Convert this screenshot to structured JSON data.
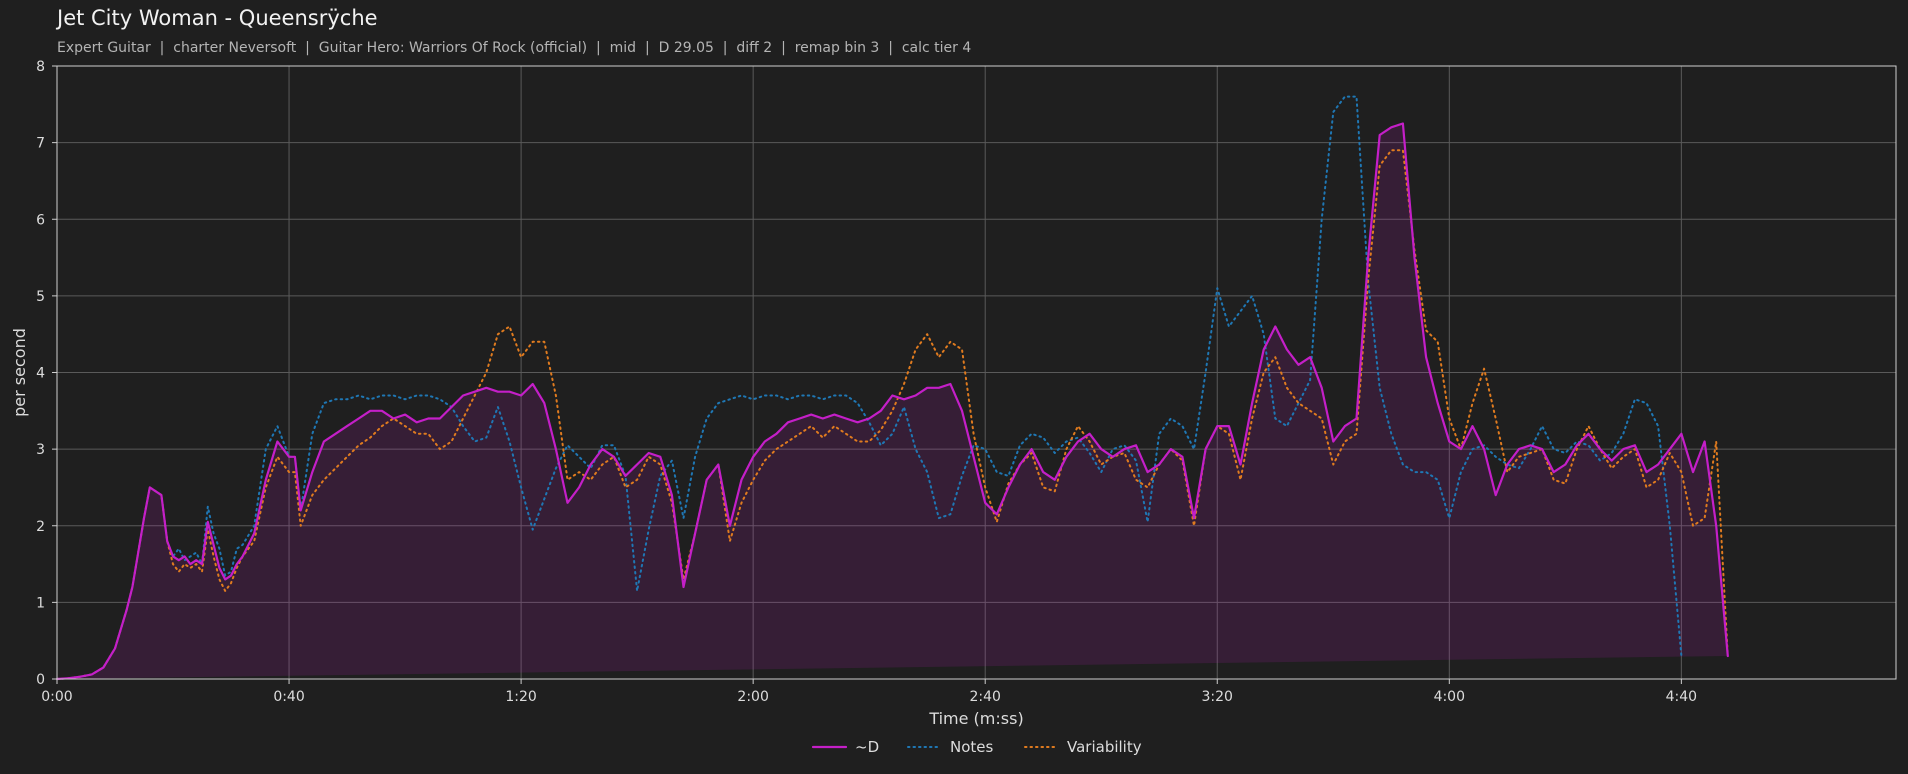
{
  "chart_data": {
    "type": "line",
    "title": "Jet City Woman - Queensrÿche",
    "subtitle": "Expert Guitar  |  charter Neversoft  |  Guitar Hero: Warriors Of Rock (official)  |  mid  |  D 29.05  |  diff 2  |  remap bin 3  |  calc tier 4",
    "xlabel": "Time (m:ss)",
    "ylabel": "per second",
    "xlim": [
      0,
      317
    ],
    "ylim": [
      0,
      8
    ],
    "x_ticks": [
      {
        "v": 0,
        "label": "0:00"
      },
      {
        "v": 40,
        "label": "0:40"
      },
      {
        "v": 80,
        "label": "1:20"
      },
      {
        "v": 120,
        "label": "2:00"
      },
      {
        "v": 160,
        "label": "2:40"
      },
      {
        "v": 200,
        "label": "3:20"
      },
      {
        "v": 240,
        "label": "4:00"
      },
      {
        "v": 280,
        "label": "4:40"
      }
    ],
    "y_ticks": [
      0,
      1,
      2,
      3,
      4,
      5,
      6,
      7,
      8
    ],
    "grid": true,
    "legend_position": "bottom-center",
    "x": [
      0,
      2,
      4,
      6,
      8,
      10,
      12,
      13,
      15,
      16,
      18,
      19,
      20,
      21,
      22,
      23,
      24,
      25,
      26,
      27,
      28,
      29,
      30,
      31,
      32,
      34,
      36,
      38,
      40,
      41,
      42,
      44,
      46,
      48,
      50,
      52,
      54,
      56,
      58,
      60,
      62,
      64,
      66,
      68,
      70,
      72,
      74,
      76,
      78,
      80,
      82,
      84,
      86,
      88,
      90,
      92,
      94,
      96,
      98,
      100,
      102,
      104,
      106,
      108,
      110,
      112,
      114,
      116,
      118,
      120,
      122,
      124,
      126,
      128,
      130,
      132,
      134,
      136,
      138,
      140,
      142,
      144,
      146,
      148,
      150,
      152,
      154,
      156,
      158,
      160,
      162,
      164,
      166,
      168,
      170,
      172,
      174,
      176,
      178,
      180,
      182,
      184,
      186,
      188,
      190,
      192,
      194,
      196,
      198,
      200,
      202,
      204,
      206,
      208,
      210,
      212,
      214,
      216,
      218,
      220,
      222,
      224,
      226,
      228,
      230,
      232,
      234,
      236,
      238,
      240,
      242,
      244,
      246,
      248,
      250,
      252,
      254,
      256,
      258,
      260,
      262,
      264,
      266,
      268,
      270,
      272,
      274,
      276,
      278,
      280,
      282,
      284,
      286,
      288,
      290,
      292,
      294,
      296,
      298,
      300,
      302,
      304,
      306,
      308,
      310,
      312,
      314,
      316,
      317
    ],
    "series": [
      {
        "name": "~D",
        "style": "solid",
        "color": "#c41fc8",
        "values": [
          0,
          0.01,
          0.03,
          0.06,
          0.15,
          0.4,
          0.9,
          1.2,
          2.1,
          2.5,
          2.4,
          1.8,
          1.6,
          1.55,
          1.6,
          1.5,
          1.55,
          1.5,
          2.05,
          1.75,
          1.45,
          1.3,
          1.35,
          1.5,
          1.6,
          1.9,
          2.6,
          3.1,
          2.9,
          2.9,
          2.2,
          2.7,
          3.1,
          3.2,
          3.3,
          3.4,
          3.5,
          3.5,
          3.4,
          3.45,
          3.35,
          3.4,
          3.4,
          3.55,
          3.7,
          3.75,
          3.8,
          3.75,
          3.75,
          3.7,
          3.85,
          3.6,
          3.0,
          2.3,
          2.5,
          2.8,
          3.0,
          2.9,
          2.65,
          2.8,
          2.95,
          2.9,
          2.4,
          1.2,
          1.9,
          2.6,
          2.8,
          2.0,
          2.6,
          2.9,
          3.1,
          3.2,
          3.35,
          3.4,
          3.45,
          3.4,
          3.45,
          3.4,
          3.35,
          3.4,
          3.5,
          3.7,
          3.65,
          3.7,
          3.8,
          3.8,
          3.85,
          3.5,
          2.9,
          2.3,
          2.15,
          2.5,
          2.8,
          3.0,
          2.7,
          2.6,
          2.9,
          3.1,
          3.2,
          3.0,
          2.9,
          3.0,
          3.05,
          2.7,
          2.8,
          3.0,
          2.9,
          2.1,
          3.0,
          3.3,
          3.3,
          2.8,
          3.6,
          4.3,
          4.6,
          4.3,
          4.1,
          4.2,
          3.8,
          3.1,
          3.3,
          3.4,
          5.5,
          7.1,
          7.2,
          7.25,
          5.5,
          4.2,
          3.6,
          3.1,
          3.0,
          3.3,
          3.0,
          2.4,
          2.8,
          3.0,
          3.05,
          3.0,
          2.7,
          2.8,
          3.05,
          3.2,
          3.0,
          2.85,
          3.0,
          3.05,
          2.7,
          2.8,
          3.0,
          3.2,
          2.7,
          3.1,
          2.0,
          0.3
        ]
      },
      {
        "name": "Notes",
        "style": "dotted",
        "color": "#1f77b4",
        "values": [
          0,
          0.01,
          0.03,
          0.06,
          0.15,
          0.4,
          0.9,
          1.2,
          2.1,
          2.5,
          2.4,
          1.8,
          1.6,
          1.7,
          1.55,
          1.6,
          1.65,
          1.5,
          2.25,
          1.9,
          1.7,
          1.35,
          1.4,
          1.7,
          1.75,
          2.0,
          3.0,
          3.3,
          2.9,
          2.9,
          2.2,
          3.2,
          3.6,
          3.65,
          3.65,
          3.7,
          3.65,
          3.7,
          3.7,
          3.65,
          3.7,
          3.7,
          3.65,
          3.55,
          3.3,
          3.1,
          3.15,
          3.55,
          3.1,
          2.5,
          1.95,
          2.35,
          2.75,
          3.05,
          2.9,
          2.75,
          3.05,
          3.05,
          2.65,
          1.15,
          1.95,
          2.65,
          2.85,
          2.1,
          2.9,
          3.4,
          3.6,
          3.65,
          3.7,
          3.65,
          3.7,
          3.7,
          3.65,
          3.7,
          3.7,
          3.65,
          3.7,
          3.7,
          3.6,
          3.35,
          3.05,
          3.2,
          3.55,
          3.0,
          2.7,
          2.1,
          2.15,
          2.65,
          3.05,
          3.0,
          2.7,
          2.65,
          3.05,
          3.2,
          3.15,
          2.95,
          3.1,
          3.15,
          2.95,
          2.7,
          3.0,
          3.05,
          2.85,
          2.05,
          3.2,
          3.4,
          3.3,
          3.0,
          4.0,
          5.1,
          4.6,
          4.8,
          5.0,
          4.5,
          3.4,
          3.3,
          3.6,
          3.9,
          6.0,
          7.4,
          7.6,
          7.6,
          5.2,
          3.8,
          3.2,
          2.8,
          2.7,
          2.7,
          2.6,
          2.1,
          2.7,
          3.0,
          3.05,
          2.9,
          2.8,
          2.75,
          3.0,
          3.3,
          3.0,
          2.95,
          3.1,
          3.05,
          2.85,
          2.95,
          3.2,
          3.65,
          3.6,
          3.3,
          2.0,
          0.3
        ]
      },
      {
        "name": "Variability",
        "style": "dotted",
        "color": "#e07b1f",
        "values": [
          0,
          0.01,
          0.03,
          0.06,
          0.15,
          0.4,
          0.9,
          1.2,
          2.1,
          2.5,
          2.4,
          1.8,
          1.5,
          1.4,
          1.5,
          1.45,
          1.5,
          1.4,
          1.95,
          1.6,
          1.3,
          1.15,
          1.25,
          1.45,
          1.6,
          1.8,
          2.5,
          2.9,
          2.7,
          2.7,
          2.0,
          2.4,
          2.6,
          2.75,
          2.9,
          3.05,
          3.15,
          3.3,
          3.4,
          3.3,
          3.2,
          3.2,
          3.0,
          3.1,
          3.4,
          3.7,
          4.0,
          4.5,
          4.6,
          4.2,
          4.4,
          4.4,
          3.7,
          2.6,
          2.7,
          2.6,
          2.8,
          2.9,
          2.5,
          2.6,
          2.9,
          2.8,
          2.3,
          1.3,
          1.9,
          2.6,
          2.8,
          1.8,
          2.3,
          2.6,
          2.85,
          3.0,
          3.1,
          3.2,
          3.3,
          3.15,
          3.3,
          3.2,
          3.1,
          3.1,
          3.25,
          3.5,
          3.85,
          4.3,
          4.5,
          4.2,
          4.4,
          4.3,
          3.2,
          2.5,
          2.05,
          2.55,
          2.8,
          2.95,
          2.5,
          2.45,
          3.0,
          3.3,
          3.1,
          2.8,
          2.9,
          2.95,
          2.6,
          2.5,
          2.8,
          3.0,
          2.85,
          2.0,
          3.0,
          3.3,
          3.2,
          2.6,
          3.4,
          4.0,
          4.2,
          3.8,
          3.6,
          3.5,
          3.4,
          2.8,
          3.1,
          3.2,
          5.2,
          6.7,
          6.9,
          6.9,
          5.6,
          4.55,
          4.4,
          3.4,
          3.0,
          3.6,
          4.05,
          3.4,
          2.7,
          2.9,
          2.95,
          3.0,
          2.6,
          2.55,
          3.0,
          3.3,
          3.0,
          2.75,
          2.9,
          3.0,
          2.5,
          2.6,
          2.95,
          2.7,
          2.0,
          2.1,
          3.1,
          0.3
        ]
      }
    ]
  }
}
